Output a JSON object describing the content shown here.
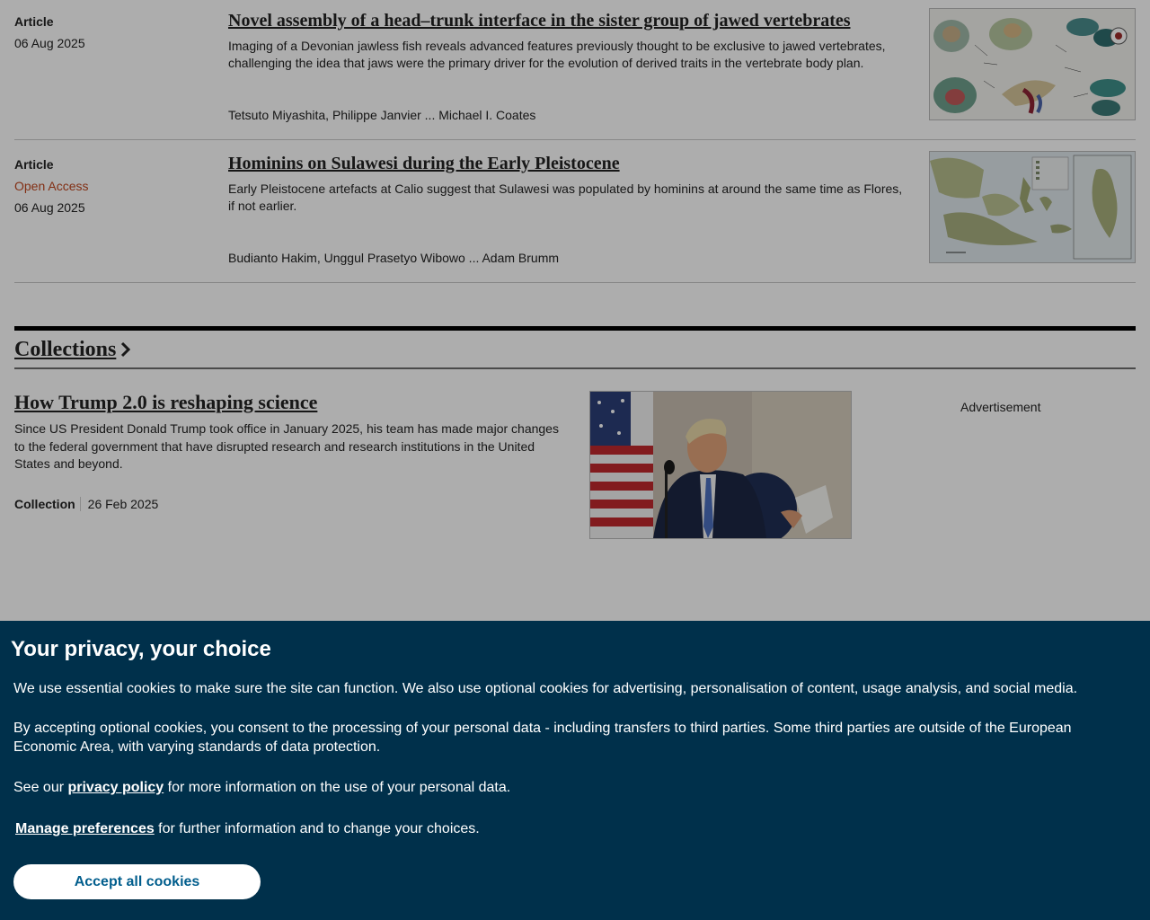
{
  "articles": [
    {
      "type": "Article",
      "access": "",
      "date": "06 Aug 2025",
      "title": "Novel assembly of a head–trunk interface in the sister group of jawed vertebrates",
      "description": "Imaging of a Devonian jawless fish reveals advanced features previously thought to be exclusive to jawed vertebrates, challenging the idea that jaws were the primary driver for the evolution of derived traits in the vertebrate body plan.",
      "authors": "Tetsuto Miyashita, Philippe Janvier ... Michael I. Coates"
    },
    {
      "type": "Article",
      "access": "Open Access",
      "date": "06 Aug 2025",
      "title": "Hominins on Sulawesi during the Early Pleistocene",
      "description": "Early Pleistocene artefacts at Calio suggest that Sulawesi was populated by hominins at around the same time as Flores, if not earlier.",
      "authors": "Budianto Hakim, Unggul Prasetyo Wibowo ... Adam Brumm"
    }
  ],
  "collections": {
    "heading": "Collections",
    "item": {
      "title": "How Trump 2.0 is reshaping science",
      "description": "Since US President Donald Trump took office in January 2025, his team has made major changes to the federal government that have disrupted research and research institutions in the United States and beyond.",
      "type": "Collection",
      "date": "26 Feb 2025"
    },
    "advertisement_label": "Advertisement"
  },
  "cookie_banner": {
    "heading": "Your privacy, your choice",
    "para1": "We use essential cookies to make sure the site can function. We also use optional cookies for advertising, personalisation of content, usage analysis, and social media.",
    "para2": "By accepting optional cookies, you consent to the processing of your personal data - including transfers to third parties. Some third parties are outside of the European Economic Area, with varying standards of data protection.",
    "para3_prefix": "See our ",
    "privacy_link": "privacy policy",
    "para3_suffix": " for more information on the use of your personal data.",
    "manage_link": "Manage preferences",
    "manage_suffix": " for further information and to change your choices.",
    "accept_button": "Accept all cookies"
  },
  "colors": {
    "banner_bg": "#00304b",
    "accept_text": "#025e8d",
    "open_access": "#c0461e"
  }
}
